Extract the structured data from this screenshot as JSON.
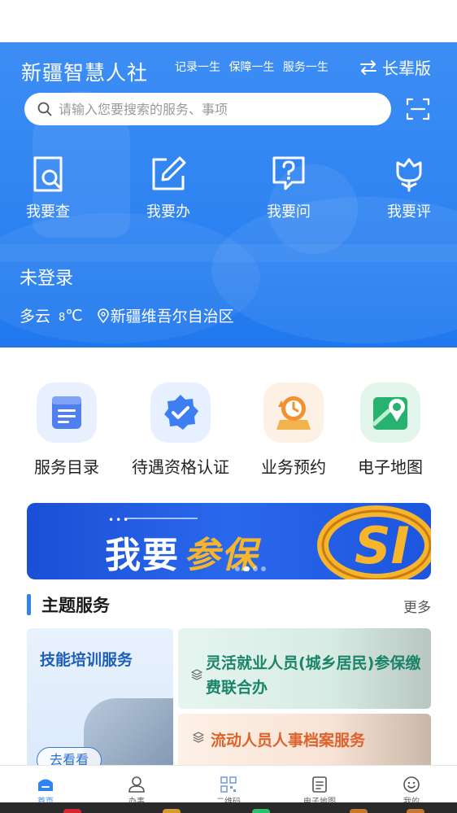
{
  "header": {
    "app_title": "新疆智慧人社",
    "slogans": [
      "记录一生",
      "保障一生",
      "服务一生"
    ],
    "elder_mode_label": "长辈版"
  },
  "search": {
    "placeholder": "请输入您要搜索的服务、事项"
  },
  "quick_actions": [
    {
      "label": "我要查",
      "icon": "search-doc-icon"
    },
    {
      "label": "我要办",
      "icon": "edit-icon"
    },
    {
      "label": "我要问",
      "icon": "question-icon"
    },
    {
      "label": "我要评",
      "icon": "tulip-icon"
    }
  ],
  "user": {
    "login_status": "未登录"
  },
  "weather": {
    "condition": "多云",
    "temperature_value": "8",
    "temperature_unit": "℃",
    "location": "新疆维吾尔自治区"
  },
  "services": [
    {
      "label": "服务目录",
      "icon": "catalog-icon",
      "color": "#4f7ff0"
    },
    {
      "label": "待遇资格认证",
      "icon": "verified-badge-icon",
      "color": "#3d7ef2"
    },
    {
      "label": "业务预约",
      "icon": "appointment-clock-icon",
      "color": "#f2912e"
    },
    {
      "label": "电子地图",
      "icon": "map-pin-icon",
      "color": "#27b36f"
    }
  ],
  "banner": {
    "text_white": "我要",
    "text_gold": "参保",
    "logo_text": "SI"
  },
  "theme_section": {
    "title": "主题服务",
    "more_label": "更多"
  },
  "theme_cards": {
    "skills_training": {
      "title": "技能培训服务",
      "button": "去看看"
    },
    "flexible_employment": {
      "title": "灵活就业人员(城乡居民)参保缴费联合办"
    },
    "floating_archive": {
      "title": "流动人员人事档案服务"
    }
  },
  "tabbar": [
    {
      "label": "首页",
      "icon": "home-icon",
      "active": true
    },
    {
      "label": "办事",
      "icon": "user-icon",
      "active": false
    },
    {
      "label": "二维码",
      "icon": "qr-code-icon",
      "active": false
    },
    {
      "label": "电子地图",
      "icon": "map-doc-icon",
      "active": false
    },
    {
      "label": "我的",
      "icon": "smile-icon",
      "active": false
    }
  ],
  "colors": {
    "primary": "#2f84f2",
    "header_gradient_top": "#3d8df4",
    "banner_gold": "#f6b52b"
  }
}
